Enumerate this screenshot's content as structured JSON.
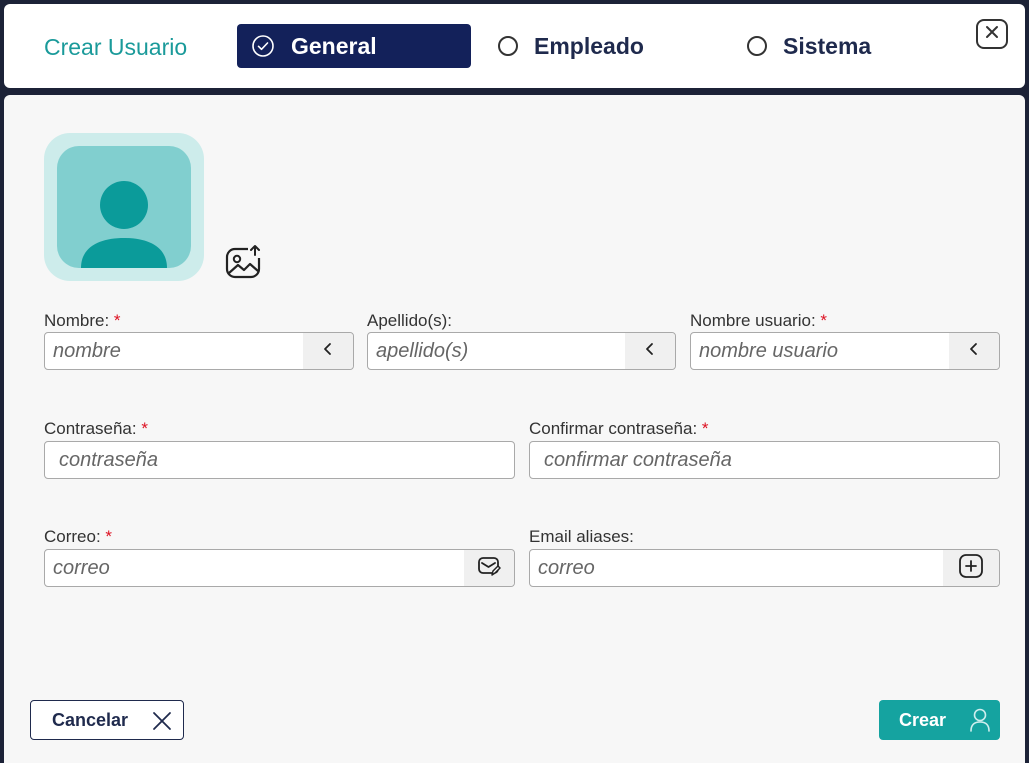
{
  "header": {
    "title": "Crear Usuario",
    "tabs": [
      {
        "label": "General",
        "active": true
      },
      {
        "label": "Empleado",
        "active": false
      },
      {
        "label": "Sistema",
        "active": false
      }
    ]
  },
  "form": {
    "nombre": {
      "label": "Nombre:",
      "required": "*",
      "placeholder": "nombre"
    },
    "apellido": {
      "label": "Apellido(s):",
      "placeholder": "apellido(s)"
    },
    "usuario": {
      "label": "Nombre usuario:",
      "required": "*",
      "placeholder": "nombre usuario"
    },
    "contrasena": {
      "label": "Contraseña:",
      "required": "*",
      "placeholder": "contraseña"
    },
    "confirmar": {
      "label": "Confirmar contraseña:",
      "required": "*",
      "placeholder": "confirmar contraseña"
    },
    "correo": {
      "label": "Correo:",
      "required": "*",
      "placeholder": "correo"
    },
    "aliases": {
      "label": "Email aliases:",
      "placeholder": "correo"
    }
  },
  "footer": {
    "cancel_label": "Cancelar",
    "create_label": "Crear"
  },
  "colors": {
    "accent": "#15a3a0",
    "navy": "#13215a",
    "required": "#dd1122"
  },
  "icons": [
    "check-circle-icon",
    "radio-icon",
    "close-icon",
    "user-avatar-icon",
    "image-upload-icon",
    "chevron-left-icon",
    "mail-edit-icon",
    "plus-square-icon",
    "x-icon",
    "user-icon"
  ]
}
